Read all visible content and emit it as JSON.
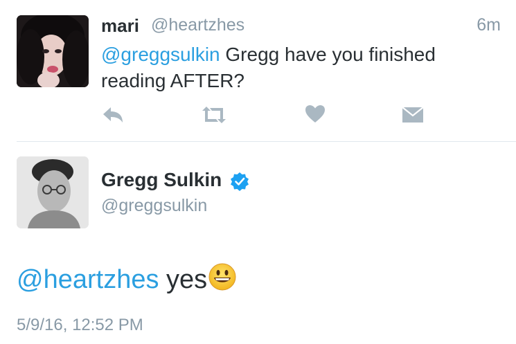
{
  "tweet_reply": {
    "author_name": "mari",
    "author_handle": "@heartzhes",
    "time_ago": "6m",
    "mention": "@greggsulkin",
    "text": " Gregg have you finished reading AFTER?"
  },
  "tweet_main": {
    "author_name": "Gregg Sulkin",
    "author_handle": "@greggsulkin",
    "mention": "@heartzhes",
    "text": " yes",
    "emoji": "grinning-face",
    "date": "5/9/16, 12:52 PM",
    "verified": true
  },
  "colors": {
    "link": "#2b9fe0",
    "muted": "#8899a6",
    "text": "#292f33",
    "action_icon": "#aab8c2",
    "verified": "#1da1f2"
  },
  "icons": [
    "reply-icon",
    "retweet-icon",
    "like-heart-icon",
    "direct-message-icon",
    "verified-badge-icon",
    "grinning-emoji-icon"
  ]
}
